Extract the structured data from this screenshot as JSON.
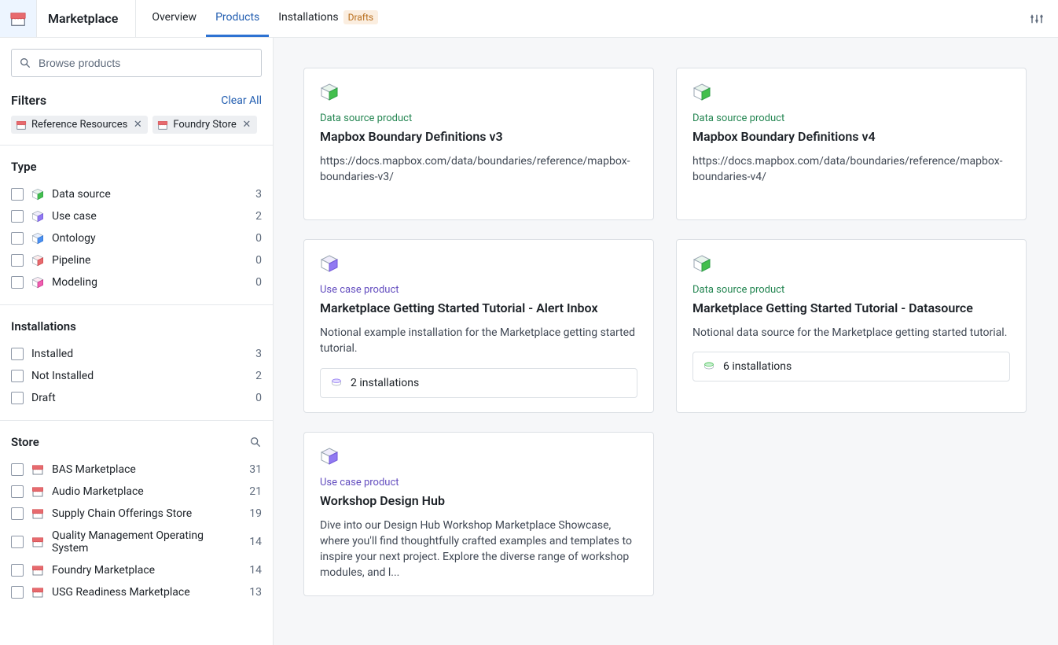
{
  "app": {
    "title": "Marketplace"
  },
  "tabs": {
    "overview": "Overview",
    "products": "Products",
    "installations": "Installations",
    "drafts_badge": "Drafts"
  },
  "search": {
    "placeholder": "Browse products"
  },
  "filters": {
    "heading": "Filters",
    "clear": "Clear All",
    "chips": [
      {
        "label": "Reference Resources"
      },
      {
        "label": "Foundry Store"
      }
    ]
  },
  "facets": {
    "type": {
      "title": "Type",
      "items": [
        {
          "label": "Data source",
          "count": "3",
          "icon": "ds"
        },
        {
          "label": "Use case",
          "count": "2",
          "icon": "uc"
        },
        {
          "label": "Ontology",
          "count": "0",
          "icon": "on"
        },
        {
          "label": "Pipeline",
          "count": "0",
          "icon": "pl"
        },
        {
          "label": "Modeling",
          "count": "0",
          "icon": "md"
        }
      ]
    },
    "installations": {
      "title": "Installations",
      "items": [
        {
          "label": "Installed",
          "count": "3"
        },
        {
          "label": "Not Installed",
          "count": "2"
        },
        {
          "label": "Draft",
          "count": "0"
        }
      ]
    },
    "store": {
      "title": "Store",
      "items": [
        {
          "label": "BAS Marketplace",
          "count": "31"
        },
        {
          "label": "Audio Marketplace",
          "count": "21"
        },
        {
          "label": "Supply Chain Offerings Store",
          "count": "19"
        },
        {
          "label": "Quality Management Operating System",
          "count": "14"
        },
        {
          "label": "Foundry Marketplace",
          "count": "14"
        },
        {
          "label": "USG Readiness Marketplace",
          "count": "13"
        }
      ]
    }
  },
  "cards": [
    {
      "category_label": "Data source product",
      "category_class": "cat-data-source",
      "icon": "ds",
      "title": "Mapbox Boundary Definitions v3",
      "desc": "https://docs.mapbox.com/data/boundaries/reference/mapbox-boundaries-v3/",
      "installations": null
    },
    {
      "category_label": "Data source product",
      "category_class": "cat-data-source",
      "icon": "ds",
      "title": "Mapbox Boundary Definitions v4",
      "desc": "https://docs.mapbox.com/data/boundaries/reference/mapbox-boundaries-v4/",
      "installations": null
    },
    {
      "category_label": "Use case product",
      "category_class": "cat-use-case",
      "icon": "uc",
      "title": "Marketplace Getting Started Tutorial - Alert Inbox",
      "desc": "Notional example installation for the Marketplace getting started tutorial.",
      "installations": "2 installations",
      "pill_icon": "uc"
    },
    {
      "category_label": "Data source product",
      "category_class": "cat-data-source",
      "icon": "ds",
      "title": "Marketplace Getting Started Tutorial - Datasource",
      "desc": "Notional data source for the Marketplace getting started tutorial.",
      "installations": "6 installations",
      "pill_icon": "ds"
    },
    {
      "category_label": "Use case product",
      "category_class": "cat-use-case",
      "icon": "uc",
      "title": "Workshop Design Hub",
      "desc": "Dive into our Design Hub Workshop Marketplace Showcase, where you'll find thoughtfully crafted examples and templates to inspire your next project. Explore the diverse range of workshop modules, and l...",
      "installations": null
    }
  ]
}
